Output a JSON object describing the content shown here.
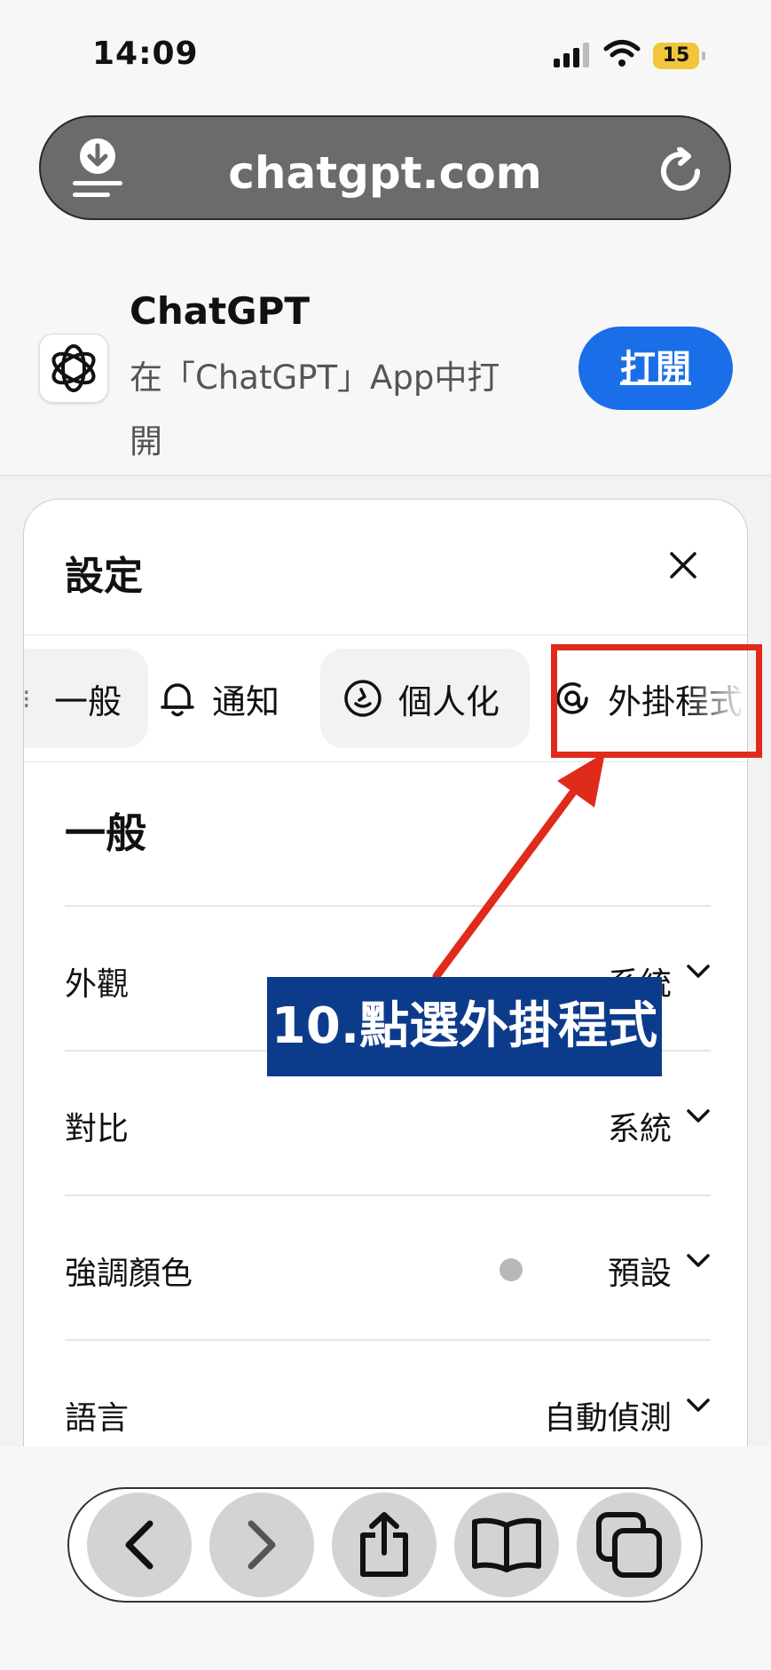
{
  "status_bar": {
    "time": "14:09",
    "battery": "15"
  },
  "url_bar": {
    "url": "chatgpt.com"
  },
  "app_banner": {
    "name": "ChatGPT",
    "description": "在「ChatGPT」App中打開",
    "open_label": "打開"
  },
  "settings": {
    "title": "設定",
    "tabs": [
      {
        "label": "一般",
        "icon": "gear-icon"
      },
      {
        "label": "通知",
        "icon": "bell-icon"
      },
      {
        "label": "個人化",
        "icon": "smile-icon"
      },
      {
        "label": "外掛程式",
        "icon": "plugin-icon"
      }
    ],
    "section_title": "一般",
    "rows": [
      {
        "label": "外觀",
        "value": "系統"
      },
      {
        "label": "對比",
        "value": "系統"
      },
      {
        "label": "強調顏色",
        "value": "預設",
        "dot_color": "#b8b8b8"
      },
      {
        "label": "語言",
        "value": "自動偵測"
      }
    ]
  },
  "annotation": {
    "callout": "10.點選外掛程式",
    "color": "#e02a1c",
    "callout_bg": "#0d3b8c"
  },
  "toolbar": {
    "buttons": [
      "back-icon",
      "forward-icon",
      "share-icon",
      "bookmarks-icon",
      "tabs-icon"
    ]
  }
}
